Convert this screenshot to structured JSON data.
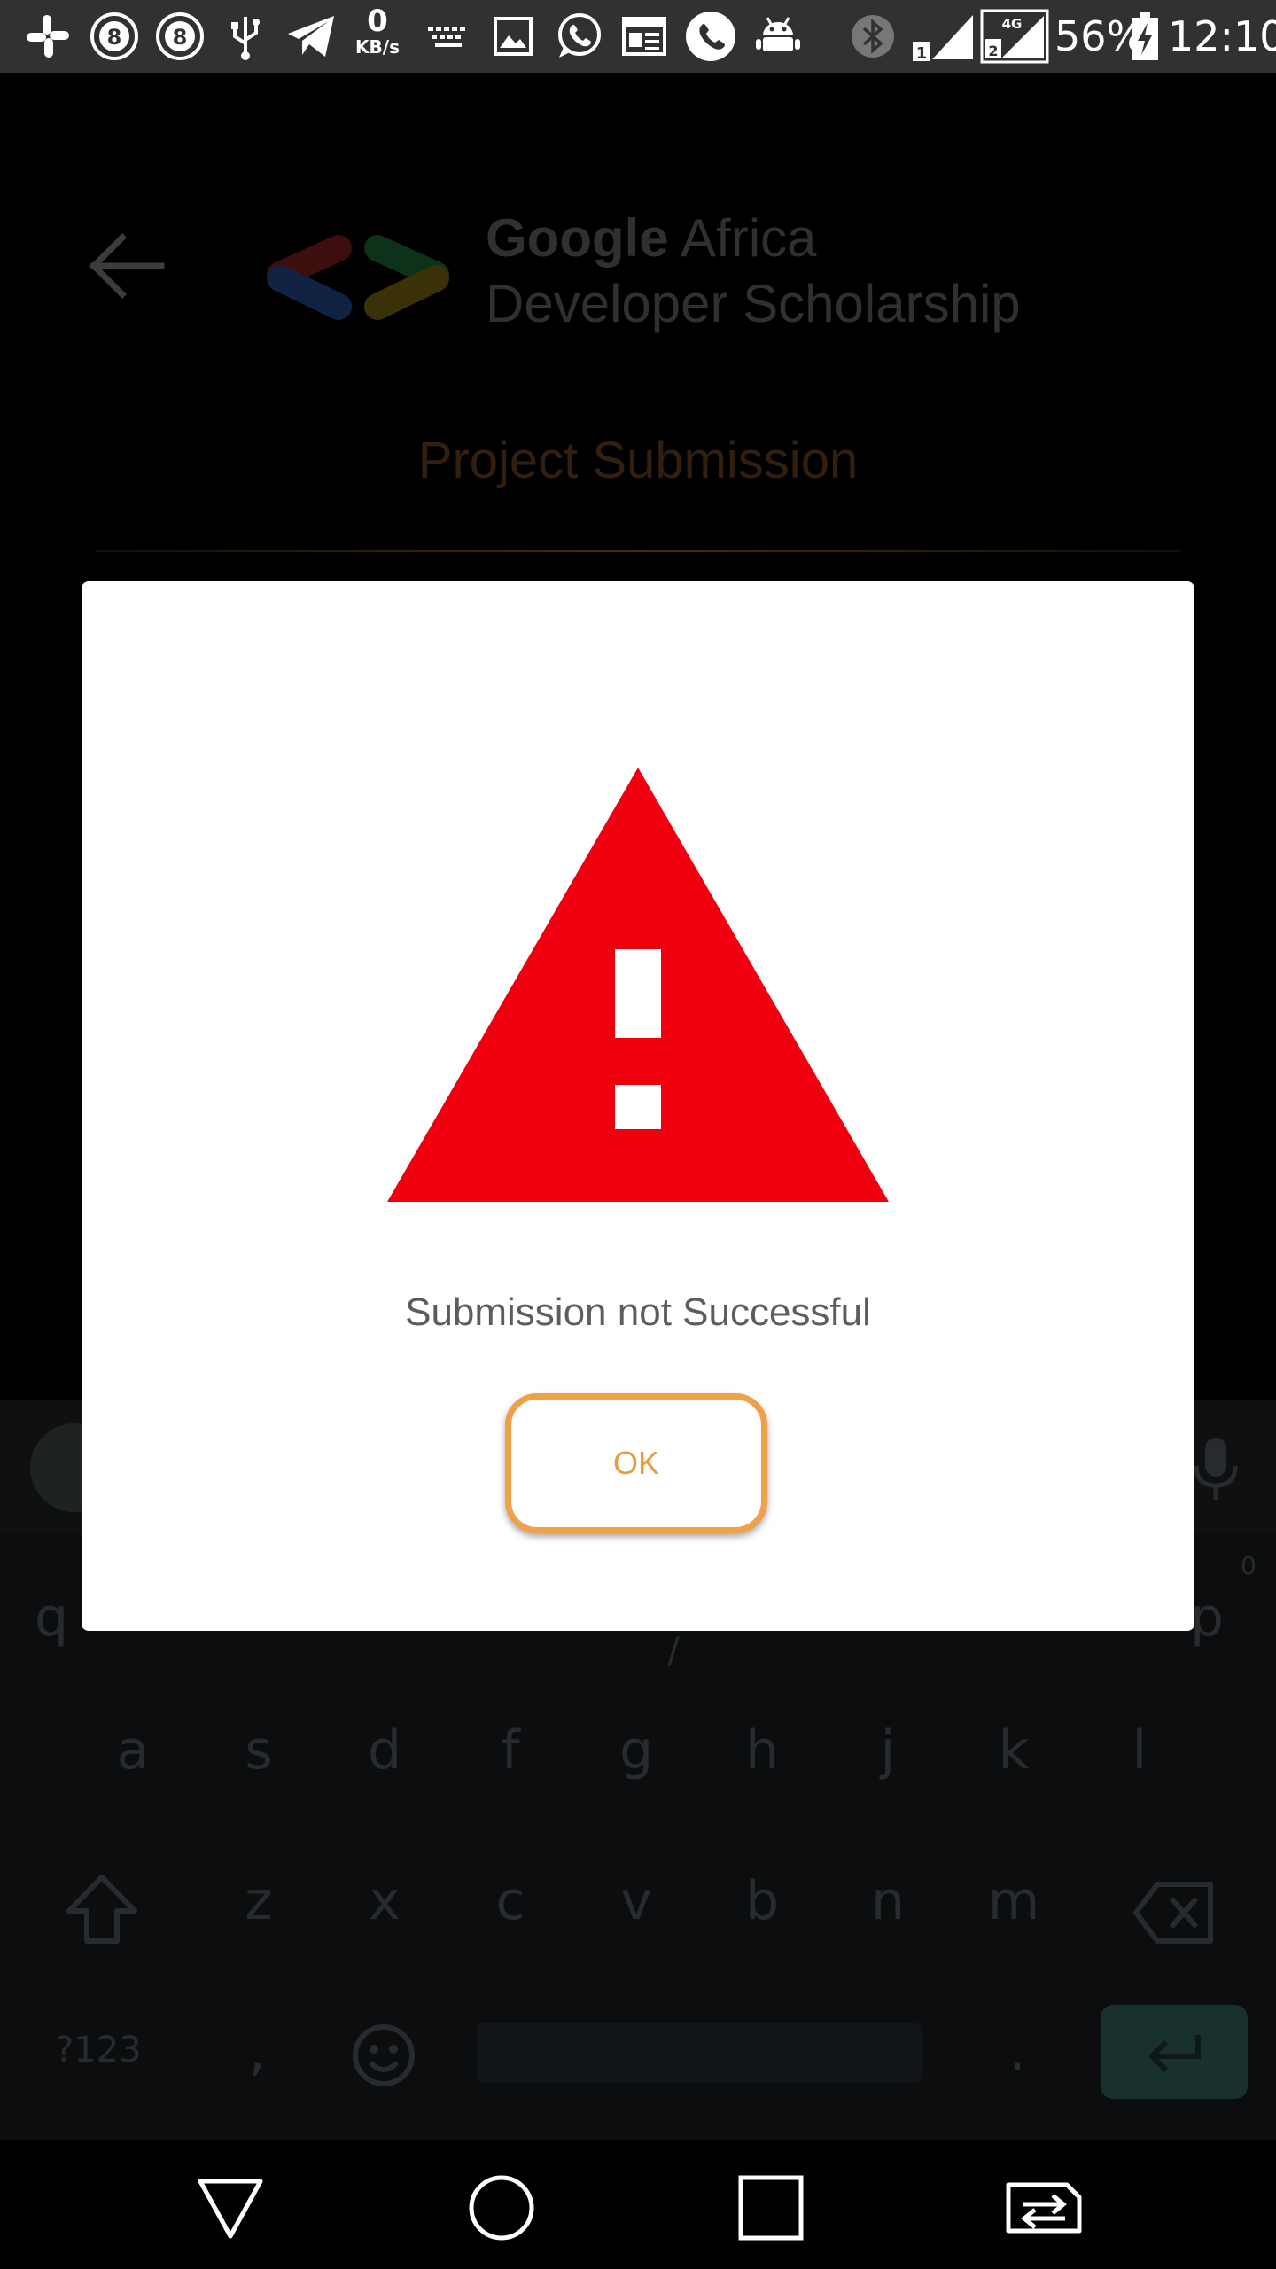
{
  "status_bar": {
    "net_speed_value": "0",
    "net_speed_unit": "KB/s",
    "battery": "56%",
    "time": "12:10",
    "sim1": "1",
    "sim2": "2",
    "network_type": "4G",
    "notification_icons": [
      "slack-icon",
      "badge-8-icon",
      "badge-8-icon",
      "usb-icon",
      "telegram-icon",
      "keyboard-icon",
      "gallery-icon",
      "whatsapp-icon",
      "news-icon",
      "phone-icon",
      "android-icon"
    ]
  },
  "header": {
    "brand_line1_bold": "Google",
    "brand_line1_rest": " Africa",
    "brand_line2": "Developer Scholarship"
  },
  "page": {
    "title": "Project Submission"
  },
  "dialog": {
    "message": "Submission not Successful",
    "ok_label": "OK",
    "icon": "warning-triangle-icon",
    "icon_color": "#f0000e",
    "button_color": "#f0a048"
  },
  "keyboard": {
    "row2": [
      "a",
      "s",
      "d",
      "f",
      "g",
      "h",
      "j",
      "k",
      "l"
    ],
    "row3": [
      "z",
      "x",
      "c",
      "v",
      "b",
      "n",
      "m"
    ],
    "symbols_label": "?123",
    "comma": ",",
    "period": ".",
    "row1_visible_left": "q",
    "row1_visible_right": "p",
    "row1_mid_fragment": "/",
    "p_hint": "0"
  },
  "colors": {
    "accent": "#f0a048",
    "title": "#5c3a1a",
    "enter_key": "#2f5a52"
  }
}
